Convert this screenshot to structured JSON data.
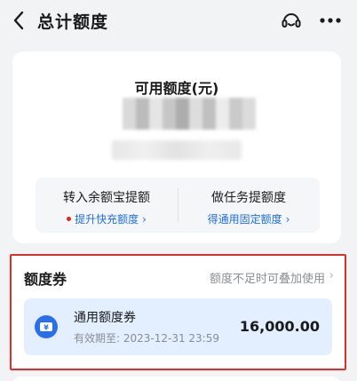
{
  "header": {
    "title": "总计额度",
    "back_icon": "chevron-left-icon",
    "service_icon": "customer-service-icon",
    "more_icon": "more-dots-icon"
  },
  "quota_card": {
    "available_label": "可用额度(元)",
    "actions": [
      {
        "title": "转入余额宝提额",
        "link": "提升快充额度",
        "has_dot": true
      },
      {
        "title": "做任务提额度",
        "link": "得通用固定额度",
        "has_dot": false
      }
    ]
  },
  "coupons": {
    "section_title": "额度券",
    "hint": "额度不足时可叠加使用",
    "items": [
      {
        "icon": "yuan-coupon-icon",
        "name": "通用额度券",
        "validity": "有效期至: 2023-12-31 23:59",
        "amount": "16,000.00"
      }
    ]
  },
  "colors": {
    "link_blue": "#1f6fe5",
    "highlight_red": "#e32d2d",
    "coupon_bg": "#e3efff",
    "coupon_icon_blue": "#2a6ef0"
  }
}
